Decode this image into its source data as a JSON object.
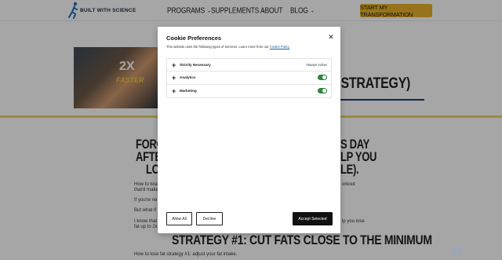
{
  "header": {
    "logo_text": "BUILT WITH SCIENCE",
    "nav": [
      {
        "label": "PROGRAMS",
        "has_dropdown": true
      },
      {
        "label": "SUPPLEMENTS",
        "has_dropdown": true
      },
      {
        "label": "ABOUT",
        "has_dropdown": false
      },
      {
        "label": "BLOG",
        "has_dropdown": true
      }
    ],
    "cta_label": "START MY TRANSFORMATION",
    "cta_color": "#e8b32a"
  },
  "hero": {
    "thumb_badge": "2X",
    "thumb_caption": "FASTER",
    "title_fragment": "S STRATEGY)"
  },
  "article": {
    "heading_left": [
      "FORGE",
      "AFTER",
      "LOS"
    ],
    "heading_right": [
      "S DAY",
      "LP YOU",
      "LE)."
    ],
    "paragraphs": [
      {
        "left": "How to lose",
        "right": "orkout"
      },
      {
        "left": "that'd make",
        "right": ""
      },
      {
        "left": "If you're ne",
        "right": ""
      },
      {
        "left": "But what if",
        "right": ""
      },
      {
        "left": "I know that",
        "right": "lp you lose"
      },
      {
        "left": "fat up to 2x",
        "right": ""
      }
    ],
    "section_heading": "STRATEGY #1: CUT FATS CLOSE TO THE MINIMUM",
    "section_intro": "How to lose fat strategy #1: adjust your fat intake."
  },
  "modal": {
    "title": "Cookie Preferences",
    "description": "This website uses the following types of services. Learn more from our",
    "policy_link": "Cookie Policy",
    "preferences": [
      {
        "label": "Strictly Necessary",
        "status": "Always Active",
        "toggle": null
      },
      {
        "label": "Analytics",
        "status": "",
        "toggle": true
      },
      {
        "label": "Marketing",
        "status": "",
        "toggle": true
      }
    ],
    "buttons": {
      "allow_all": "Allow All",
      "decline": "Decline",
      "accept_selected": "Accept Selected"
    },
    "toggle_on_color": "#2e8540"
  },
  "icons": {
    "close": "close-icon",
    "expand": "plus-icon",
    "chevron": "chevron-down-icon",
    "recaptcha": "recaptcha-icon"
  }
}
